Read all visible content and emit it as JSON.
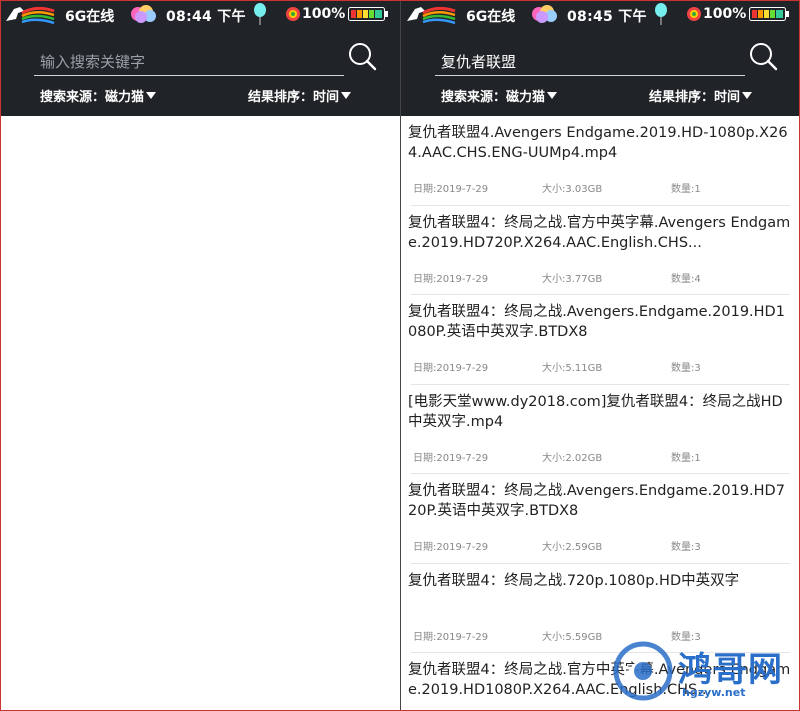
{
  "left": {
    "status": {
      "network": "6G在线",
      "time": "08:44 下午",
      "battery_pct": "100%"
    },
    "search": {
      "value": "",
      "placeholder": "输入搜索关键字"
    },
    "source_label": "搜索来源：磁力猫",
    "sort_label": "结果排序：时间"
  },
  "right": {
    "status": {
      "network": "6G在线",
      "time": "08:45 下午",
      "battery_pct": "100%"
    },
    "search": {
      "value": "复仇者联盟",
      "placeholder": "输入搜索关键字"
    },
    "source_label": "搜索来源：磁力猫",
    "sort_label": "结果排序：时间",
    "results": [
      {
        "title": "复仇者联盟4.Avengers Endgame.2019.HD-1080p.X264.AAC.CHS.ENG-UUMp4.mp4",
        "date": "日期:2019-7-29",
        "size": "大小:3.03GB",
        "count": "数量:1"
      },
      {
        "title": "复仇者联盟4：终局之战.官方中英字幕.Avengers Endgame.2019.HD720P.X264.AAC.English.CHS...",
        "date": "日期:2019-7-29",
        "size": "大小:3.77GB",
        "count": "数量:4"
      },
      {
        "title": "复仇者联盟4：终局之战.Avengers.Endgame.2019.HD1080P.英语中英双字.BTDX8",
        "date": "日期:2019-7-29",
        "size": "大小:5.11GB",
        "count": "数量:3"
      },
      {
        "title": "[电影天堂www.dy2018.com]复仇者联盟4：终局之战HD中英双字.mp4",
        "date": "日期:2019-7-29",
        "size": "大小:2.02GB",
        "count": "数量:1"
      },
      {
        "title": "复仇者联盟4：终局之战.Avengers.Endgame.2019.HD720P.英语中英双字.BTDX8",
        "date": "日期:2019-7-29",
        "size": "大小:2.59GB",
        "count": "数量:3"
      },
      {
        "title": "复仇者联盟4：终局之战.720p.1080p.HD中英双字",
        "date": "日期:2019-7-29",
        "size": "大小:5.59GB",
        "count": "数量:3"
      },
      {
        "title": "复仇者联盟4：终局之战.官方中英字幕.Avengers Endgame.2019.HD1080P.X264.AAC.English.CHS...",
        "date": "",
        "size": "",
        "count": ""
      }
    ]
  },
  "watermark": {
    "text": "鸿哥网",
    "url": "hgzyw.net"
  },
  "colors": {
    "header_bg": "#202327",
    "title_text": "#222222",
    "meta_text": "#888888",
    "watermark": "#2a6fc9"
  }
}
